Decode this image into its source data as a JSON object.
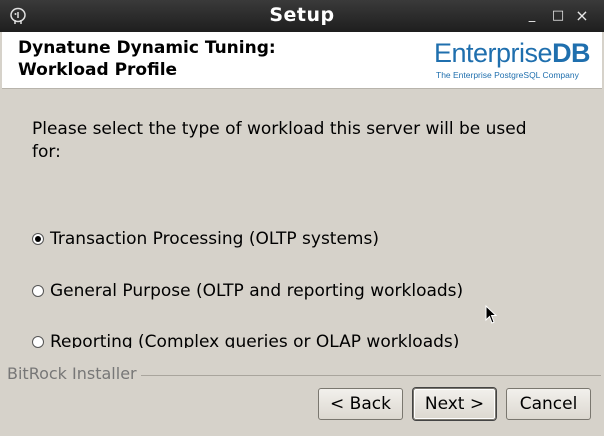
{
  "window": {
    "title": "Setup",
    "app_icon": "postgres-elephant-icon"
  },
  "window_controls": {
    "minimize": "_",
    "maximize": "□",
    "close": "×"
  },
  "header": {
    "title": "Dynatune Dynamic Tuning:\nWorkload Profile",
    "logo": {
      "word_main": "Enterprise",
      "word_bold": "DB",
      "tagline": "The Enterprise PostgreSQL Company"
    }
  },
  "main": {
    "question": "Please select the type of workload this server will be used for:",
    "options": [
      {
        "label": "Transaction Processing (OLTP systems)",
        "selected": true
      },
      {
        "label": "General Purpose (OLTP and reporting workloads)",
        "selected": false
      },
      {
        "label": "Reporting (Complex queries or OLAP workloads)",
        "selected": false
      }
    ]
  },
  "footer": {
    "installer_label": "BitRock Installer",
    "back_label": "< Back",
    "next_label": "Next >",
    "cancel_label": "Cancel"
  },
  "colors": {
    "logo_blue": "#1f6fae",
    "titlebar": "#2a2a2a",
    "background": "#d6d2ca"
  }
}
